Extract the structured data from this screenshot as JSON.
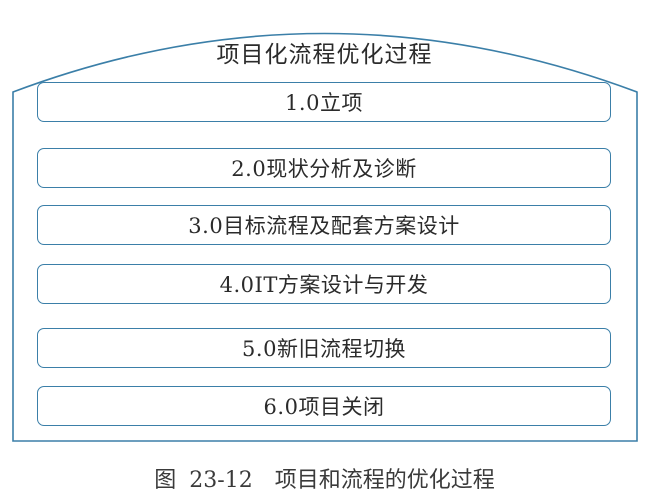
{
  "diagram": {
    "title": "项目化流程优化过程",
    "steps": [
      "1.0立项",
      "2.0现状分析及诊断",
      "3.0目标流程及配套方案设计",
      "4.0IT方案设计与开发",
      "5.0新旧流程切换",
      "6.0项目关闭"
    ]
  },
  "caption": "图 23-12　项目和流程的优化过程",
  "colors": {
    "frame_line": "#3b7fa8",
    "text": "#2b2b2b"
  }
}
